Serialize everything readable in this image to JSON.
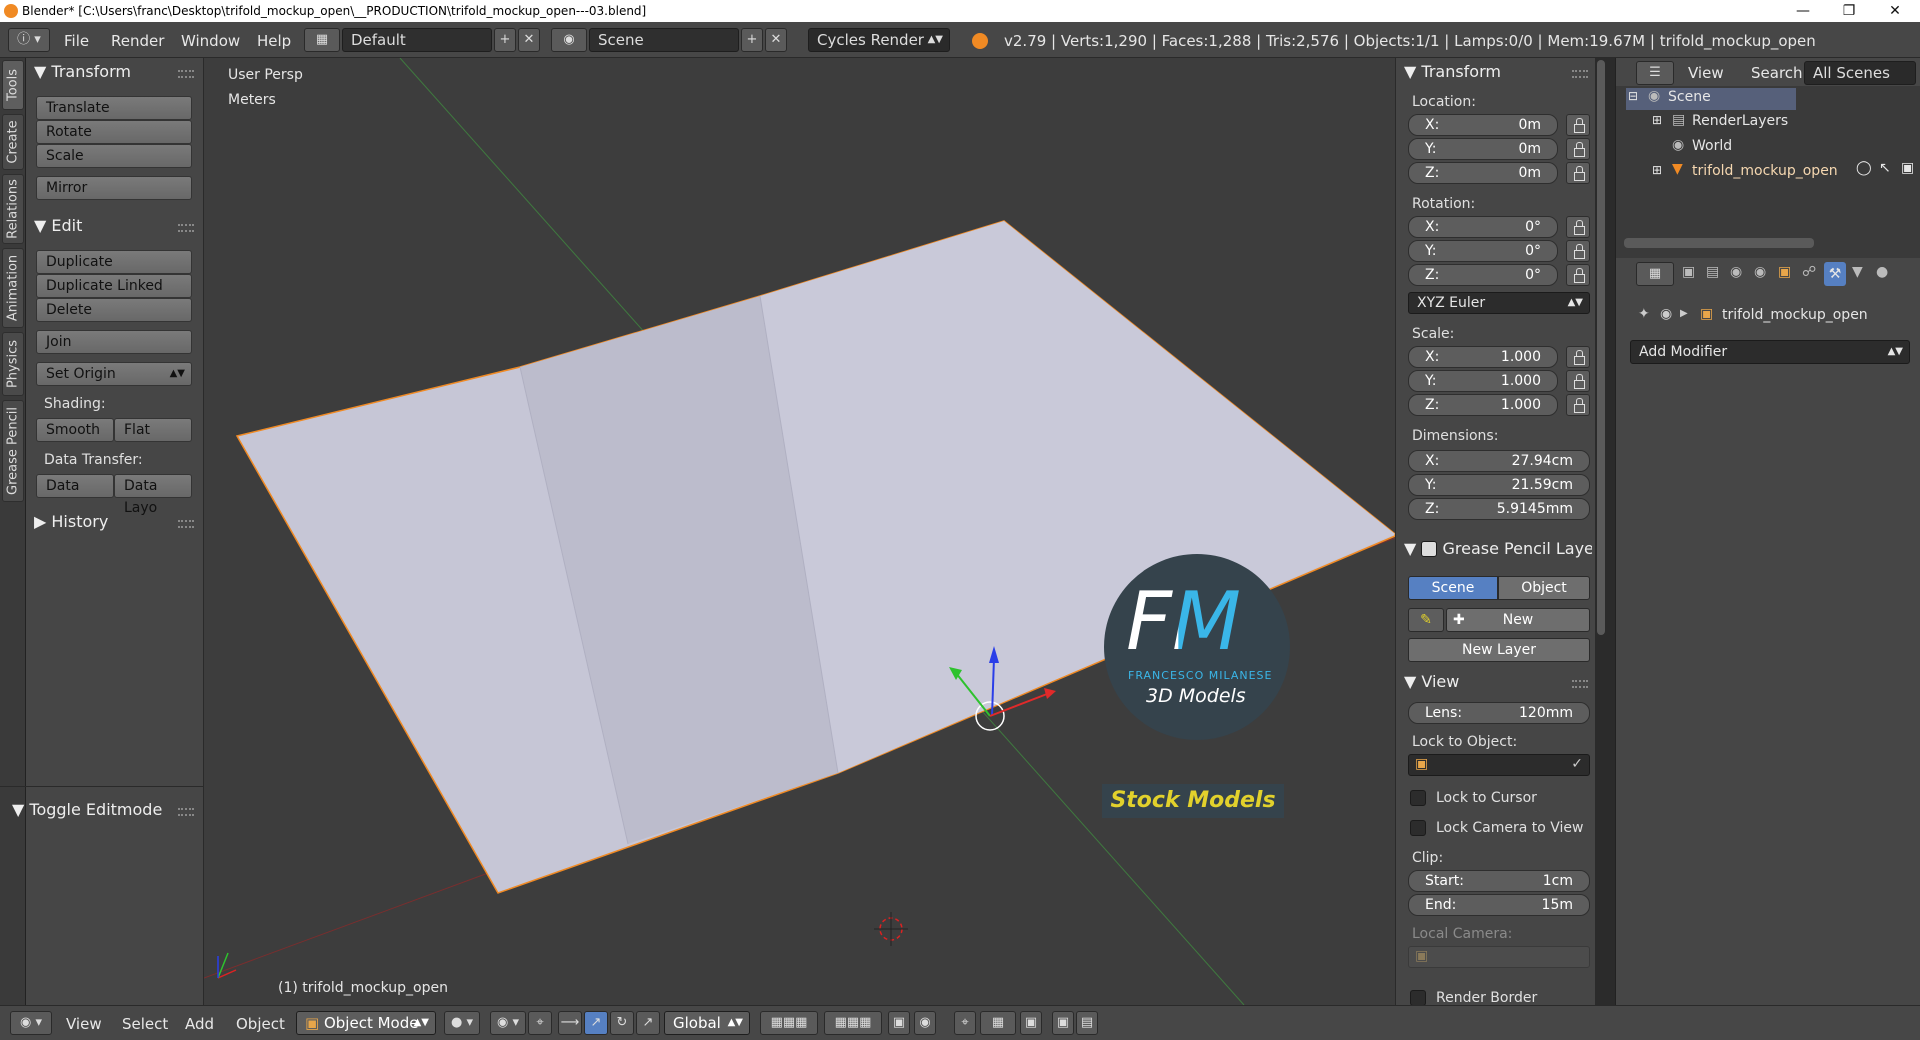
{
  "titlebar": {
    "title": "Blender* [C:\\Users\\franc\\Desktop\\trifold_mockup_open\\__PRODUCTION\\trifold_mockup_open---03.blend]"
  },
  "menu": {
    "file": "File",
    "render": "Render",
    "window": "Window",
    "help": "Help"
  },
  "header": {
    "layout": "Default",
    "scene": "Scene",
    "engine": "Cycles Render",
    "stats": "v2.79 | Verts:1,290 | Faces:1,288 | Tris:2,576 | Objects:1/1 | Lamps:0/0 | Mem:19.67M | trifold_mockup_open"
  },
  "left_tabs": [
    "Tools",
    "Create",
    "Relations",
    "Animation",
    "Physics",
    "Grease Pencil"
  ],
  "toolshelf": {
    "transform": {
      "header": "Transform",
      "translate": "Translate",
      "rotate": "Rotate",
      "scale": "Scale",
      "mirror": "Mirror"
    },
    "edit": {
      "header": "Edit",
      "duplicate": "Duplicate",
      "duplicate_linked": "Duplicate Linked",
      "delete": "Delete",
      "join": "Join",
      "set_origin": "Set Origin",
      "shading_label": "Shading:",
      "smooth": "Smooth",
      "flat": "Flat",
      "data_transfer_label": "Data Transfer:",
      "data": "Data",
      "data_layo": "Data Layo"
    },
    "history": "History",
    "toggle_editmode": "Toggle Editmode"
  },
  "viewport": {
    "view_name": "User Persp",
    "units": "Meters",
    "object_label": "(1) trifold_mockup_open",
    "watermark": {
      "fm": "FM",
      "author": "FRANCESCO MILANESE",
      "tagline": "3D Models",
      "banner": "Stock Models"
    }
  },
  "npanel": {
    "transform_header": "Transform",
    "location_label": "Location:",
    "location": [
      {
        "k": "X:",
        "v": "0m"
      },
      {
        "k": "Y:",
        "v": "0m"
      },
      {
        "k": "Z:",
        "v": "0m"
      }
    ],
    "rotation_label": "Rotation:",
    "rotation": [
      {
        "k": "X:",
        "v": "0°"
      },
      {
        "k": "Y:",
        "v": "0°"
      },
      {
        "k": "Z:",
        "v": "0°"
      }
    ],
    "rotation_mode": "XYZ Euler",
    "scale_label": "Scale:",
    "scale": [
      {
        "k": "X:",
        "v": "1.000"
      },
      {
        "k": "Y:",
        "v": "1.000"
      },
      {
        "k": "Z:",
        "v": "1.000"
      }
    ],
    "dimensions_label": "Dimensions:",
    "dimensions": [
      {
        "k": "X:",
        "v": "27.94cm"
      },
      {
        "k": "Y:",
        "v": "21.59cm"
      },
      {
        "k": "Z:",
        "v": "5.9145mm"
      }
    ],
    "grease_pencil_header": "Grease Pencil Layer",
    "scene_tab": "Scene",
    "object_tab": "Object",
    "new": "New",
    "new_layer": "New Layer",
    "view_header": "View",
    "lens_key": "Lens:",
    "lens_value": "120mm",
    "lock_to_object": "Lock to Object:",
    "lock_to_cursor": "Lock to Cursor",
    "lock_camera": "Lock Camera to View",
    "clip_label": "Clip:",
    "clip_start_key": "Start:",
    "clip_start": "1cm",
    "clip_end_key": "End:",
    "clip_end": "15m",
    "local_camera": "Local Camera:",
    "render_border": "Render Border"
  },
  "outliner": {
    "view": "View",
    "search": "Search",
    "filter": "All Scenes",
    "items": [
      "Scene",
      "RenderLayers",
      "World",
      "trifold_mockup_open"
    ]
  },
  "properties": {
    "object_name": "trifold_mockup_open",
    "add_modifier": "Add Modifier"
  },
  "bottombar": {
    "view": "View",
    "select": "Select",
    "add": "Add",
    "object": "Object",
    "mode": "Object Mode",
    "orientation": "Global"
  },
  "colors": {
    "accent_blue": "#5680c2",
    "selection_orange": "#f08a24",
    "paper": "#c6c6d6",
    "watermark_yellow": "#e2d12c"
  }
}
